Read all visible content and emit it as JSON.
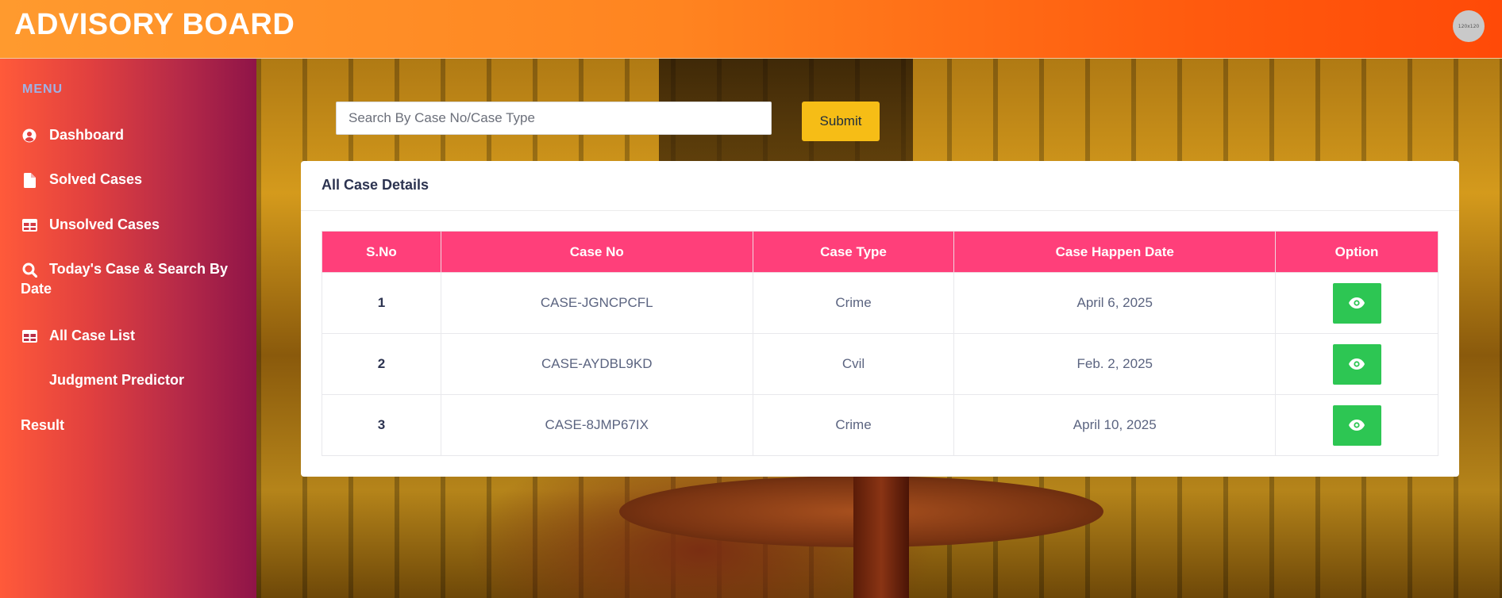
{
  "header": {
    "brand": "ADVISORY BOARD",
    "avatar_text": "120x120"
  },
  "sidebar": {
    "heading": "MENU",
    "items": [
      {
        "label": "Dashboard",
        "icon": "user-circle-icon"
      },
      {
        "label": "Solved Cases",
        "icon": "file-icon"
      },
      {
        "label": "Unsolved Cases",
        "icon": "table-icon"
      },
      {
        "label_line1": "Today's Case & Search By",
        "label_line2": "Date",
        "icon": "search-icon"
      },
      {
        "label": "All Case List",
        "icon": "table-icon"
      },
      {
        "label": "Judgment Predictor"
      },
      {
        "label": "Result"
      }
    ]
  },
  "search": {
    "placeholder": "Search By Case No/Case Type",
    "value": "",
    "submit_label": "Submit"
  },
  "card": {
    "title": "All Case Details",
    "columns": [
      "S.No",
      "Case No",
      "Case Type",
      "Case Happen Date",
      "Option"
    ],
    "rows": [
      {
        "sno": "1",
        "case_no": "CASE-JGNCPCFL",
        "case_type": "Crime",
        "date": "April 6, 2025",
        "option_icon": "eye-icon"
      },
      {
        "sno": "2",
        "case_no": "CASE-AYDBL9KD",
        "case_type": "Cvil",
        "date": "Feb. 2, 2025",
        "option_icon": "eye-icon"
      },
      {
        "sno": "3",
        "case_no": "CASE-8JMP67IX",
        "case_type": "Crime",
        "date": "April 10, 2025",
        "option_icon": "eye-icon"
      }
    ]
  },
  "colors": {
    "header_start": "#ff9a2e",
    "header_end": "#ff4a08",
    "sidebar_start": "#ff5a3a",
    "sidebar_end": "#8f1448",
    "table_header": "#ff3f7a",
    "submit": "#f6bd16",
    "view_button": "#2dc653"
  }
}
